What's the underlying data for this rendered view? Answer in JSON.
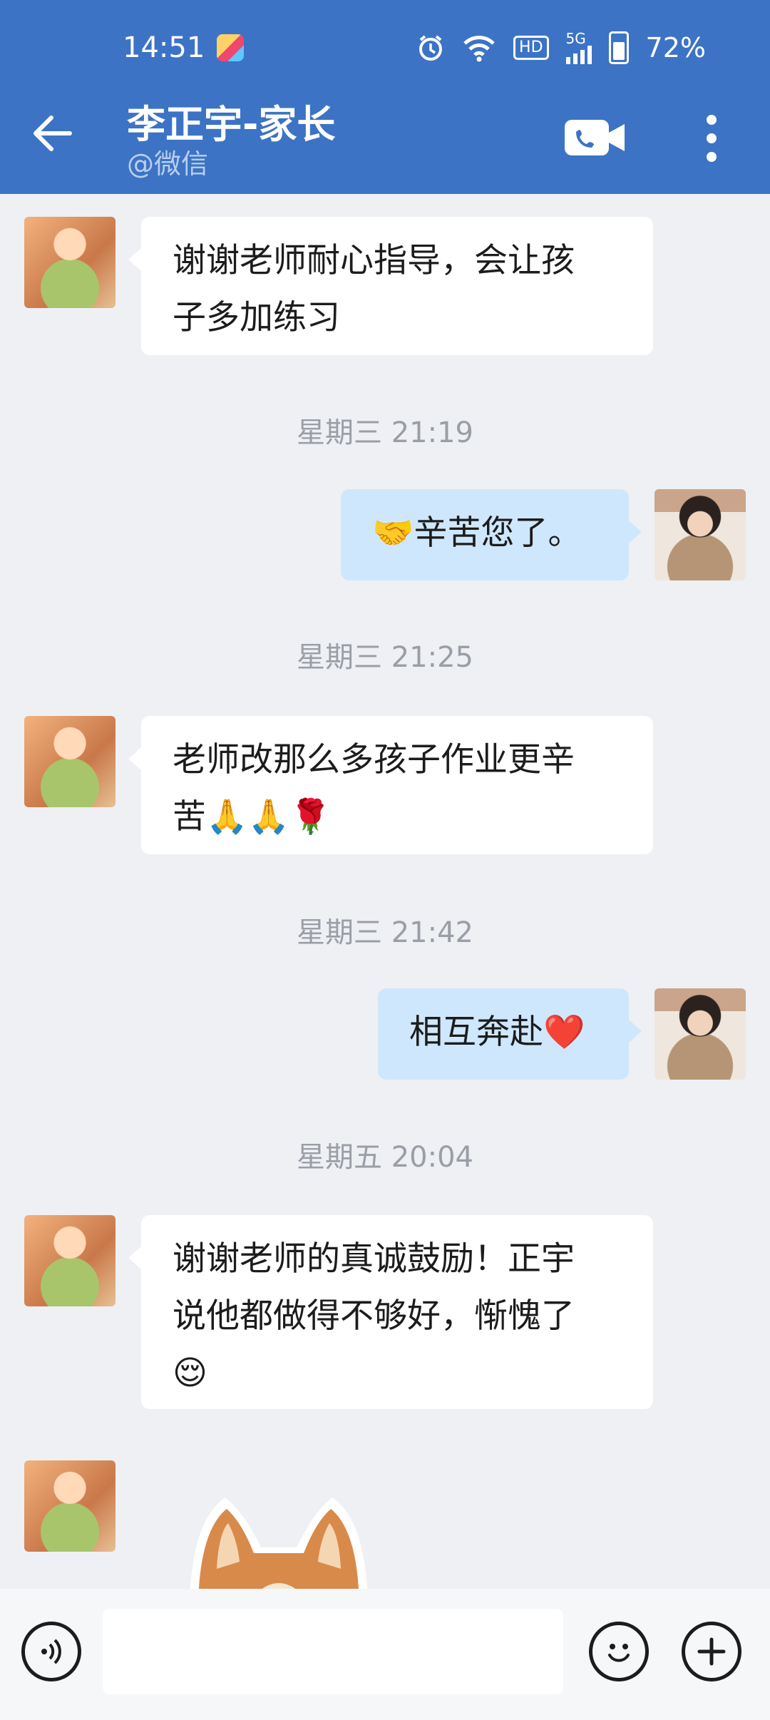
{
  "status_bar": {
    "time": "14:51",
    "network": "5G",
    "battery": "72%",
    "hd_label": "HD"
  },
  "header": {
    "title": "李正宇-家长",
    "subtitle": "@微信"
  },
  "messages": [
    {
      "side": "left",
      "text": "谢谢老师耐心指导，会让孩\n子多加练习"
    },
    {
      "type": "timestamp",
      "text": "星期三 21:19"
    },
    {
      "side": "right",
      "text": "🤝辛苦您了。"
    },
    {
      "type": "timestamp",
      "text": "星期三 21:25"
    },
    {
      "side": "left",
      "text": "老师改那么多孩子作业更辛\n苦🙏🙏🌹"
    },
    {
      "type": "timestamp",
      "text": "星期三 21:42"
    },
    {
      "side": "right",
      "text": "相互奔赴❤️"
    },
    {
      "type": "timestamp",
      "text": "星期五 20:04"
    },
    {
      "side": "left",
      "text": "谢谢老师的真诚鼓励！正宇\n说他都做得不够好，惭愧了\n😌"
    }
  ],
  "sticker": {
    "icon": "shiba-dog-sticker"
  },
  "input": {
    "placeholder": "",
    "value": ""
  },
  "colors": {
    "header": "#3c73c5",
    "chat_bg": "#eef0f4",
    "bubble_left": "#ffffff",
    "bubble_right": "#cfe7fd"
  }
}
